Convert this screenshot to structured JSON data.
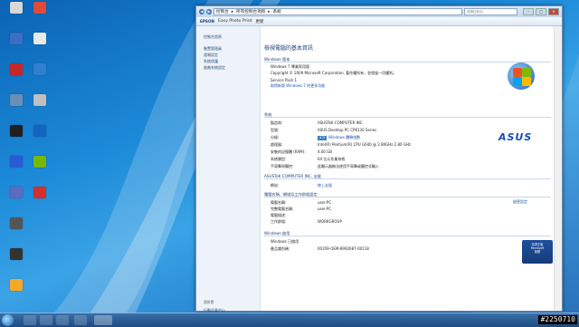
{
  "desktop_icons": [
    {
      "label": "",
      "color": "#d7d7d7",
      "x": 0,
      "y": 0
    },
    {
      "label": "",
      "color": "#e04a3a",
      "x": 1,
      "y": 0
    },
    {
      "label": "",
      "color": "#3b6fc4",
      "x": 0,
      "y": 1
    },
    {
      "label": "",
      "color": "#e8e8e8",
      "x": 1,
      "y": 1
    },
    {
      "label": "",
      "color": "#c62828",
      "x": 0,
      "y": 2
    },
    {
      "label": "",
      "color": "#2f7fd0",
      "x": 1,
      "y": 2
    },
    {
      "label": "",
      "color": "#6a8fb5",
      "x": 0,
      "y": 3
    },
    {
      "label": "",
      "color": "#c0c0c0",
      "x": 1,
      "y": 3
    },
    {
      "label": "",
      "color": "#202020",
      "x": 0,
      "y": 4
    },
    {
      "label": "",
      "color": "#1565c0",
      "x": 1,
      "y": 4
    },
    {
      "label": "",
      "color": "#2a5bd7",
      "x": 0,
      "y": 5
    },
    {
      "label": "",
      "color": "#76b900",
      "x": 1,
      "y": 5
    },
    {
      "label": "",
      "color": "#5c6bc0",
      "x": 0,
      "y": 6
    },
    {
      "label": "",
      "color": "#d32f2f",
      "x": 1,
      "y": 6
    },
    {
      "label": "",
      "color": "#555555",
      "x": 0,
      "y": 7
    },
    {
      "label": "",
      "color": "#333333",
      "x": 0,
      "y": 8
    },
    {
      "label": "",
      "color": "#f9a825",
      "x": 0,
      "y": 9
    }
  ],
  "window": {
    "breadcrumb": [
      "控制台",
      "所有控制台項目",
      "系統"
    ],
    "search_placeholder": "搜尋控制台",
    "toolbar": {
      "brand": "EPSON",
      "app": "Easy Photo Print",
      "update": "更新"
    },
    "left_nav": {
      "home": "控制台首頁",
      "items": [
        "裝置管理員",
        "遠端設定",
        "系統保護",
        "進階系統設定"
      ],
      "see_also": "請參閱",
      "refs": [
        "行動作業中心",
        "Windows Update",
        "效能資訊及工具"
      ]
    },
    "main": {
      "title": "檢視電腦的基本資訊",
      "edition_header": "Windows 版本",
      "edition_lines": [
        "Windows 7 專業家用版",
        "Copyright © 2009 Microsoft Corporation. 著作權所有，並保留一切權利。",
        "Service Pack 1",
        "取得新版 Windows 7 的更多功能"
      ],
      "system_header": "系統",
      "system_rows": [
        {
          "label": "製造商:",
          "value": "ASUSTeK COMPUTER INC."
        },
        {
          "label": "型號:",
          "value": "ASUS Desktop PC CP6130 Series"
        },
        {
          "label": "分級:",
          "value": "Windows 體驗指數"
        },
        {
          "label": "處理器:",
          "value": "Intel(R) Pentium(R) CPU G640 @ 2.80GHz   2.80 GHz"
        },
        {
          "label": "安裝的記憶體 (RAM):",
          "value": "4.00 GB"
        },
        {
          "label": "系統類型:",
          "value": "64 位元作業系統"
        },
        {
          "label": "手寫筆與觸控:",
          "value": "此顯示器無法使用手寫筆或觸控式輸入"
        }
      ],
      "score": "4.9",
      "support_header": "ASUSTeK COMPUTER INC. 支援",
      "support_rows": [
        {
          "label": "網站:",
          "value": "線上支援"
        }
      ],
      "computer_header": "電腦名稱、網域及工作群組設定",
      "computer_rows": [
        {
          "label": "電腦名稱:",
          "value": "user-PC"
        },
        {
          "label": "完整電腦名稱:",
          "value": "user-PC"
        },
        {
          "label": "電腦描述:",
          "value": ""
        },
        {
          "label": "工作群組:",
          "value": "WORKGROUP"
        }
      ],
      "change_settings": "變更設定",
      "activation_header": "Windows 啟用",
      "activation_rows": [
        {
          "label": "",
          "value": "Windows 已啟用"
        },
        {
          "label": "產品識別碼:",
          "value": "00359-OEM-8992687-00118"
        }
      ],
      "genuine": [
        "請求正版",
        "Microsoft",
        "軟體"
      ],
      "asus_logo": "ASUS"
    }
  },
  "taskbar": {
    "tray_icons": [
      "network-icon",
      "volume-icon"
    ]
  },
  "watermark": "#2250710"
}
